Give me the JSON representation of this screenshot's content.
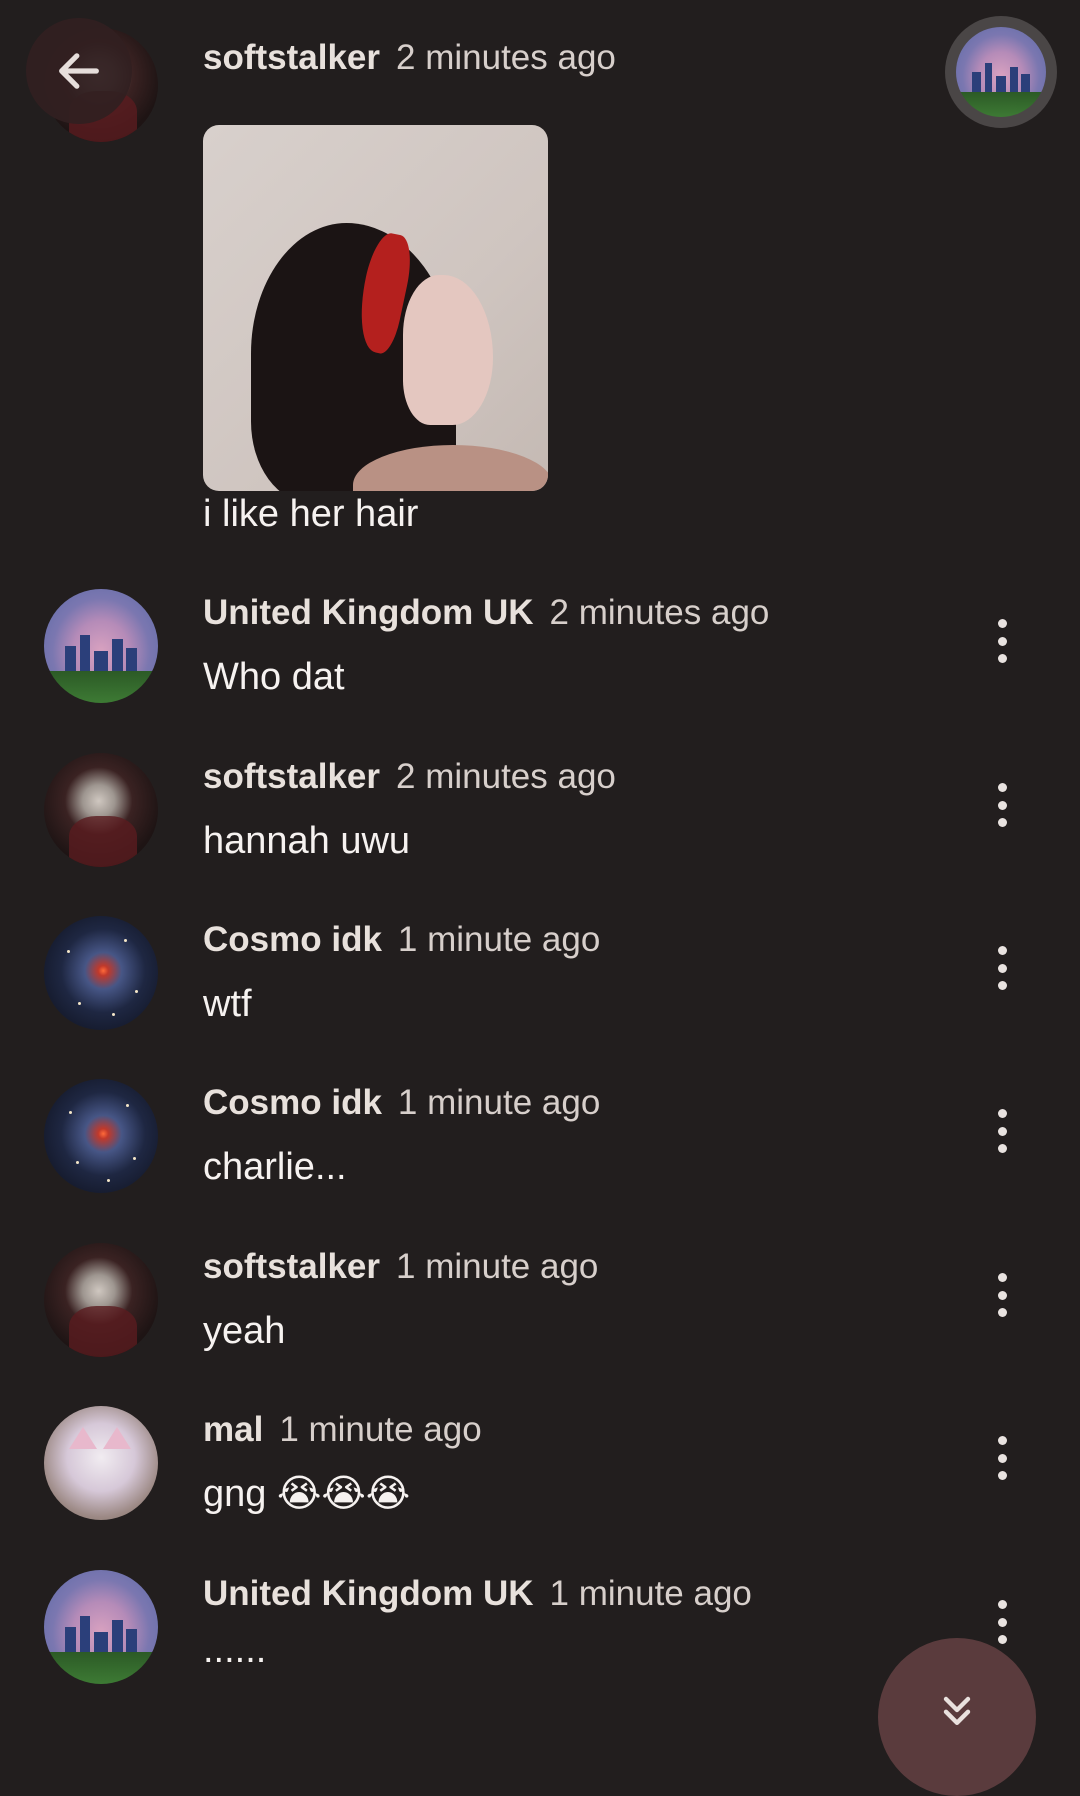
{
  "header": {
    "back_icon": "arrow-left-icon",
    "top_avatar": "city-avatar"
  },
  "messages": [
    {
      "username": "softstalker",
      "time": "2 minutes ago",
      "has_image": true,
      "text": "i like her hair",
      "avatar": "skull-avatar"
    },
    {
      "username": "United Kingdom UK",
      "time": "2 minutes ago",
      "text": "Who dat",
      "avatar": "city-avatar"
    },
    {
      "username": "softstalker",
      "time": "2 minutes ago",
      "text": "hannah uwu",
      "avatar": "skull-avatar"
    },
    {
      "username": "Cosmo idk",
      "time": "1 minute ago",
      "text": "wtf",
      "avatar": "space-avatar"
    },
    {
      "username": "Cosmo idk",
      "time": "1 minute ago",
      "text": "charlie...",
      "avatar": "space-avatar"
    },
    {
      "username": "softstalker",
      "time": "1 minute ago",
      "text": "yeah",
      "avatar": "skull-avatar"
    },
    {
      "username": "mal",
      "time": "1 minute ago",
      "text": "gng 😭😭😭",
      "avatar": "cat-avatar"
    },
    {
      "username": "United Kingdom UK",
      "time": "1 minute ago",
      "text": "......",
      "avatar": "city-avatar"
    }
  ],
  "controls": {
    "more_icon": "more-vertical-icon",
    "scroll_down_icon": "chevrons-down-icon"
  },
  "colors": {
    "background": "#221e1e",
    "text": "#f1ecea",
    "fab": "#5a3b3d"
  }
}
